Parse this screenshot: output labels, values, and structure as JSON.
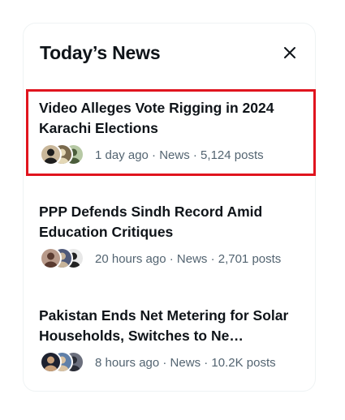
{
  "panel": {
    "title": "Today’s News",
    "close_icon": "close-icon"
  },
  "news": [
    {
      "headline": "Video Alleges Vote Rigging in 2024 Karachi Elections",
      "meta": "1 day ago · News · 5,124 posts",
      "avatars": [
        {
          "bg": "#c9b79a",
          "fg": "#1d1d1d"
        },
        {
          "bg": "#7a6a4d",
          "fg": "#e4d8b6"
        },
        {
          "bg": "#b7c9a5",
          "fg": "#4b5d3b"
        }
      ],
      "highlighted": true
    },
    {
      "headline": "PPP Defends Sindh Record Amid Education Critiques",
      "meta": "20 hours ago · News · 2,701 posts",
      "avatars": [
        {
          "bg": "#b89a8a",
          "fg": "#5a3b30"
        },
        {
          "bg": "#4f5a7a",
          "fg": "#c7b49a"
        },
        {
          "bg": "#e8e8e8",
          "fg": "#222222"
        }
      ],
      "highlighted": false
    },
    {
      "headline": "Pakistan Ends Net Metering for Solar Households, Switches to Ne…",
      "meta": "8 hours ago · News · 10.2K posts",
      "avatars": [
        {
          "bg": "#1e2230",
          "fg": "#c8a07a"
        },
        {
          "bg": "#5f7fa8",
          "fg": "#d9c2a2"
        },
        {
          "bg": "#6b6f7d",
          "fg": "#2a2d36"
        }
      ],
      "highlighted": false
    }
  ],
  "colors": {
    "text": "#0f1419",
    "secondary": "#536471",
    "highlight_border": "#e0141e"
  }
}
